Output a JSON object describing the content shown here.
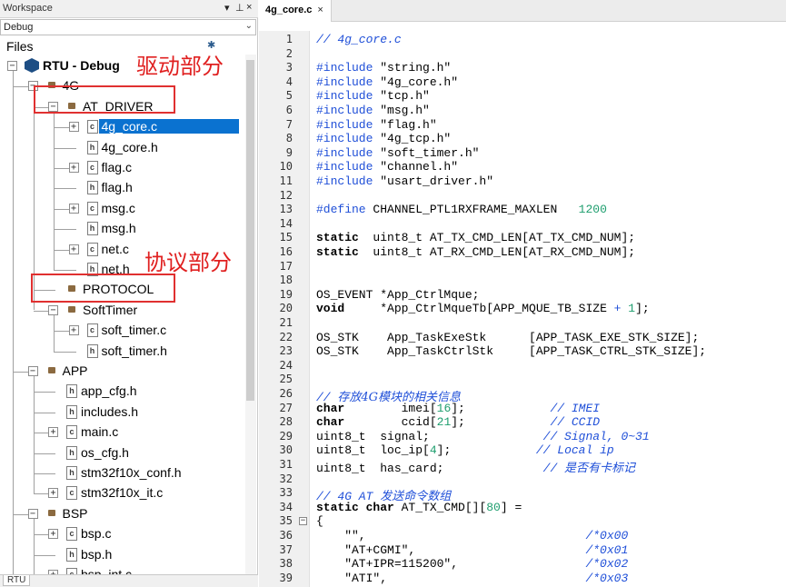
{
  "workspace": {
    "title": "Workspace",
    "pin_label": "▾ ⊥ ×",
    "config": "Debug",
    "files_label": "Files",
    "bottom_tab": "RTU",
    "tree": [
      {
        "label": "RTU - Debug",
        "type": "root",
        "expander": "⊟",
        "selected": false
      },
      {
        "label": "4G",
        "type": "folder",
        "expander": "−",
        "selected": false
      },
      {
        "label": "AT_DRIVER",
        "type": "folder",
        "expander": "−",
        "selected": false
      },
      {
        "label": "4g_core.c",
        "type": "c-file",
        "expander": "+",
        "selected": true
      },
      {
        "label": "4g_core.h",
        "type": "h-file",
        "expander": "",
        "selected": false
      },
      {
        "label": "flag.c",
        "type": "c-file",
        "expander": "+",
        "selected": false
      },
      {
        "label": "flag.h",
        "type": "h-file",
        "expander": "",
        "selected": false
      },
      {
        "label": "msg.c",
        "type": "c-file",
        "expander": "+",
        "selected": false
      },
      {
        "label": "msg.h",
        "type": "h-file",
        "expander": "",
        "selected": false
      },
      {
        "label": "net.c",
        "type": "c-file",
        "expander": "+",
        "selected": false
      },
      {
        "label": "net.h",
        "type": "h-file",
        "expander": "",
        "selected": false
      },
      {
        "label": "PROTOCOL",
        "type": "folder",
        "expander": "",
        "selected": false
      },
      {
        "label": "SoftTimer",
        "type": "folder",
        "expander": "−",
        "selected": false
      },
      {
        "label": "soft_timer.c",
        "type": "c-file",
        "expander": "+",
        "selected": false
      },
      {
        "label": "soft_timer.h",
        "type": "h-file",
        "expander": "",
        "selected": false
      },
      {
        "label": "APP",
        "type": "folder",
        "expander": "−",
        "selected": false
      },
      {
        "label": "app_cfg.h",
        "type": "h-file",
        "expander": "",
        "selected": false
      },
      {
        "label": "includes.h",
        "type": "h-file",
        "expander": "",
        "selected": false
      },
      {
        "label": "main.c",
        "type": "c-file",
        "expander": "+",
        "selected": false
      },
      {
        "label": "os_cfg.h",
        "type": "h-file",
        "expander": "",
        "selected": false
      },
      {
        "label": "stm32f10x_conf.h",
        "type": "h-file",
        "expander": "",
        "selected": false
      },
      {
        "label": "stm32f10x_it.c",
        "type": "c-file",
        "expander": "+",
        "selected": false
      },
      {
        "label": "BSP",
        "type": "folder",
        "expander": "−",
        "selected": false
      },
      {
        "label": "bsp.c",
        "type": "c-file",
        "expander": "+",
        "selected": false
      },
      {
        "label": "bsp.h",
        "type": "h-file",
        "expander": "",
        "selected": false
      },
      {
        "label": "bsp_int.c",
        "type": "c-file",
        "expander": "+",
        "selected": false
      }
    ]
  },
  "annotations": {
    "driver_label": "驱动部分",
    "protocol_label": "协议部分",
    "color": "#e02020"
  },
  "editor": {
    "tab_label": "4g_core.c",
    "tab_close": "×",
    "lines": [
      {
        "n": "1",
        "fold": "",
        "parts": [
          [
            "cm",
            "// 4g_core.c"
          ]
        ]
      },
      {
        "n": "2",
        "fold": "",
        "parts": []
      },
      {
        "n": "3",
        "fold": "",
        "parts": [
          [
            "pp",
            "#include "
          ],
          [
            "st",
            "\"string.h\""
          ]
        ]
      },
      {
        "n": "4",
        "fold": "",
        "parts": [
          [
            "pp",
            "#include "
          ],
          [
            "st",
            "\"4g_core.h\""
          ]
        ]
      },
      {
        "n": "5",
        "fold": "",
        "parts": [
          [
            "pp",
            "#include "
          ],
          [
            "st",
            "\"tcp.h\""
          ]
        ]
      },
      {
        "n": "6",
        "fold": "",
        "parts": [
          [
            "pp",
            "#include "
          ],
          [
            "st",
            "\"msg.h\""
          ]
        ]
      },
      {
        "n": "7",
        "fold": "",
        "parts": [
          [
            "pp",
            "#include "
          ],
          [
            "st",
            "\"flag.h\""
          ]
        ]
      },
      {
        "n": "8",
        "fold": "",
        "parts": [
          [
            "pp",
            "#include "
          ],
          [
            "st",
            "\"4g_tcp.h\""
          ]
        ]
      },
      {
        "n": "9",
        "fold": "",
        "parts": [
          [
            "pp",
            "#include "
          ],
          [
            "st",
            "\"soft_timer.h\""
          ]
        ]
      },
      {
        "n": "10",
        "fold": "",
        "parts": [
          [
            "pp",
            "#include "
          ],
          [
            "st",
            "\"channel.h\""
          ]
        ]
      },
      {
        "n": "11",
        "fold": "",
        "parts": [
          [
            "pp",
            "#include "
          ],
          [
            "st",
            "\"usart_driver.h\""
          ]
        ]
      },
      {
        "n": "12",
        "fold": "",
        "parts": []
      },
      {
        "n": "13",
        "fold": "",
        "parts": [
          [
            "pp",
            "#define "
          ],
          [
            "tx",
            "CHANNEL_PTL1RXFRAME_MAXLEN   "
          ],
          [
            "nm",
            "1200"
          ]
        ]
      },
      {
        "n": "14",
        "fold": "",
        "parts": []
      },
      {
        "n": "15",
        "fold": "",
        "parts": [
          [
            "kw",
            "static"
          ],
          [
            "tx",
            "  uint8_t AT_TX_CMD_LEN[AT_TX_CMD_NUM];"
          ]
        ]
      },
      {
        "n": "16",
        "fold": "",
        "parts": [
          [
            "kw",
            "static"
          ],
          [
            "tx",
            "  uint8_t AT_RX_CMD_LEN[AT_RX_CMD_NUM];"
          ]
        ]
      },
      {
        "n": "17",
        "fold": "",
        "parts": []
      },
      {
        "n": "18",
        "fold": "",
        "parts": []
      },
      {
        "n": "19",
        "fold": "",
        "parts": [
          [
            "tx",
            "OS_EVENT *App_CtrlMque;"
          ]
        ]
      },
      {
        "n": "20",
        "fold": "",
        "parts": [
          [
            "kw",
            "void"
          ],
          [
            "tx",
            "     *App_CtrlMqueTb[APP_MQUE_TB_SIZE "
          ],
          [
            "op",
            "+"
          ],
          [
            "tx",
            " "
          ],
          [
            "nm",
            "1"
          ],
          [
            "tx",
            "];"
          ]
        ]
      },
      {
        "n": "21",
        "fold": "",
        "parts": []
      },
      {
        "n": "22",
        "fold": "",
        "parts": [
          [
            "tx",
            "OS_STK    App_TaskExeStk      [APP_TASK_EXE_STK_SIZE];"
          ]
        ]
      },
      {
        "n": "23",
        "fold": "",
        "parts": [
          [
            "tx",
            "OS_STK    App_TaskCtrlStk     [APP_TASK_CTRL_STK_SIZE];"
          ]
        ]
      },
      {
        "n": "24",
        "fold": "",
        "parts": []
      },
      {
        "n": "25",
        "fold": "",
        "parts": []
      },
      {
        "n": "26",
        "fold": "",
        "parts": [
          [
            "cm",
            "// "
          ],
          [
            "cmcn",
            "存放4G模块的相关信息"
          ]
        ]
      },
      {
        "n": "27",
        "fold": "",
        "parts": [
          [
            "kw",
            "char"
          ],
          [
            "tx",
            "        imei["
          ],
          [
            "nm",
            "16"
          ],
          [
            "tx",
            "];            "
          ],
          [
            "cm",
            "// IMEI"
          ]
        ]
      },
      {
        "n": "28",
        "fold": "",
        "parts": [
          [
            "kw",
            "char"
          ],
          [
            "tx",
            "        ccid["
          ],
          [
            "nm",
            "21"
          ],
          [
            "tx",
            "];            "
          ],
          [
            "cm",
            "// CCID"
          ]
        ]
      },
      {
        "n": "29",
        "fold": "",
        "parts": [
          [
            "tx",
            "uint8_t  signal;                "
          ],
          [
            "cm",
            "// Signal, 0~31"
          ]
        ]
      },
      {
        "n": "30",
        "fold": "",
        "parts": [
          [
            "tx",
            "uint8_t  loc_ip["
          ],
          [
            "nm",
            "4"
          ],
          [
            "tx",
            "];            "
          ],
          [
            "cm",
            "// Local ip"
          ]
        ]
      },
      {
        "n": "31",
        "fold": "",
        "parts": [
          [
            "tx",
            "uint8_t  has_card;              "
          ],
          [
            "cm",
            "// "
          ],
          [
            "cmcn",
            "是否有卡标记"
          ]
        ]
      },
      {
        "n": "32",
        "fold": "",
        "parts": []
      },
      {
        "n": "33",
        "fold": "",
        "parts": [
          [
            "cm",
            "// 4G AT "
          ],
          [
            "cmcn",
            "发送命令数组"
          ]
        ]
      },
      {
        "n": "34",
        "fold": "",
        "parts": [
          [
            "kw",
            "static char"
          ],
          [
            "tx",
            " AT_TX_CMD[]["
          ],
          [
            "nm",
            "80"
          ],
          [
            "tx",
            "] ="
          ]
        ]
      },
      {
        "n": "35",
        "fold": "−",
        "parts": [
          [
            "tx",
            "{"
          ]
        ]
      },
      {
        "n": "36",
        "fold": "",
        "parts": [
          [
            "tx",
            "    \"\",                               "
          ],
          [
            "cm",
            "/*0x00"
          ]
        ]
      },
      {
        "n": "37",
        "fold": "",
        "parts": [
          [
            "tx",
            "    \"AT+CGMI\",                        "
          ],
          [
            "cm",
            "/*0x01"
          ]
        ]
      },
      {
        "n": "38",
        "fold": "",
        "parts": [
          [
            "tx",
            "    \"AT+IPR=115200\",                  "
          ],
          [
            "cm",
            "/*0x02"
          ]
        ]
      },
      {
        "n": "39",
        "fold": "",
        "parts": [
          [
            "tx",
            "    \"ATI\",                            "
          ],
          [
            "cm",
            "/*0x03"
          ]
        ]
      }
    ]
  }
}
